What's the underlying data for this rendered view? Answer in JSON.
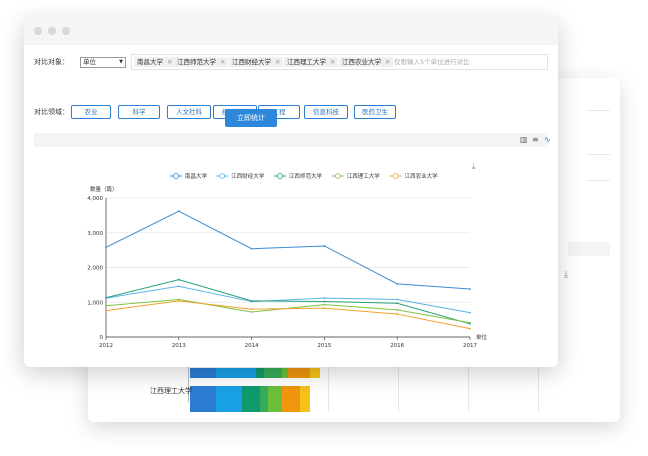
{
  "back_window": {
    "bar_rows": [
      {
        "label": ""
      },
      {
        "label": "江西理工大学"
      }
    ],
    "colors": [
      "#2b7cd3",
      "#1aa0e6",
      "#0f9a6e",
      "#36ad5a",
      "#6cbf3a",
      "#f0960e",
      "#f6c21a"
    ],
    "download_icon": "download-icon"
  },
  "front_window": {
    "filters": {
      "compare_target_label": "对比对象：",
      "unit_select_value": "单位",
      "selected_units": [
        "南昌大学",
        "江西师范大学",
        "江西财经大学",
        "江西理工大学",
        "江西农业大学"
      ],
      "tag_hint": "仅限输入5个单位进行对比",
      "compare_field_label": "对比领域：",
      "fields": [
        "农业",
        "科学",
        "人文社科",
        "经济管理",
        "工程",
        "信息科技",
        "医药卫生"
      ],
      "stat_button": "立即统计"
    },
    "toolbar_icons": [
      "bar-chart-icon",
      "sort-icon",
      "line-chart-icon"
    ],
    "download_icon": "download-icon"
  },
  "chart_data": {
    "type": "line",
    "x": [
      2012,
      2013,
      2014,
      2015,
      2016,
      2017
    ],
    "ylabel": "数量（篇）",
    "xlabel": "单位",
    "ylim": [
      0,
      4000
    ],
    "yticks": [
      "0",
      "1,000",
      "2,000",
      "3,000",
      "4,000"
    ],
    "grid": true,
    "legend_position": "top-center",
    "series": [
      {
        "name": "南昌大学",
        "color": "#3e8bd0",
        "values": [
          2580,
          3620,
          2540,
          2620,
          1530,
          1380
        ]
      },
      {
        "name": "江西财经大学",
        "color": "#5cb2e8",
        "values": [
          1120,
          1460,
          1020,
          1120,
          1080,
          700
        ]
      },
      {
        "name": "江西师范大学",
        "color": "#23a07c",
        "values": [
          1130,
          1650,
          1040,
          1020,
          970,
          380
        ]
      },
      {
        "name": "江西理工大学",
        "color": "#7fc242",
        "values": [
          900,
          1080,
          720,
          930,
          780,
          410
        ]
      },
      {
        "name": "江西农业大学",
        "color": "#f0a22e",
        "values": [
          760,
          1040,
          800,
          830,
          660,
          240
        ]
      }
    ]
  }
}
